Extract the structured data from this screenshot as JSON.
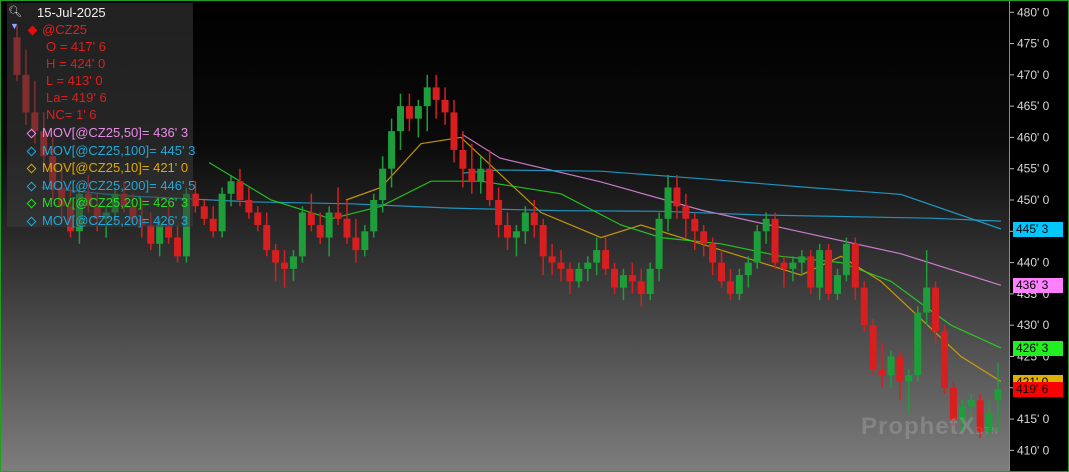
{
  "legend": {
    "date": "15-Jul-2025",
    "symbol": "@CZ25",
    "ohlc": [
      "O = 417' 6",
      "H = 424' 0",
      "L = 413' 0",
      "La= 419' 6",
      "NC= 1' 6"
    ],
    "indicators": [
      {
        "label": "MOV[@CZ25,50]= 436' 3",
        "color": "#e88ae8"
      },
      {
        "label": "MOV[@CZ25,100]= 445' 3",
        "color": "#1fa8d8"
      },
      {
        "label": "MOV[@CZ25,10]= 421' 0",
        "color": "#e0a800"
      },
      {
        "label": "MOV[@CZ25,200]= 446' 5",
        "color": "#1fa8d8"
      },
      {
        "label": "MOV[@CZ25,20]= 426' 3",
        "color": "#22dd22"
      },
      {
        "label": "MOV[@CZ25,20]= 426' 3",
        "color": "#1fa8d8"
      }
    ]
  },
  "watermark": {
    "brand": "ProphetX",
    "suffix": "DTN"
  },
  "price_tags": [
    {
      "label": "445' 3",
      "value": 445.375,
      "bg": "#00c8ff",
      "fg": "#000000"
    },
    {
      "label": "436' 3",
      "value": 436.375,
      "bg": "#ff80ff",
      "fg": "#000000"
    },
    {
      "label": "426' 3",
      "value": 426.375,
      "bg": "#22ee22",
      "fg": "#000000"
    },
    {
      "label": "421' 0",
      "value": 421.0,
      "bg": "#e0b000",
      "fg": "#000000"
    },
    {
      "label": "419' 6",
      "value": 419.75,
      "bg": "#ff0000",
      "fg": "#000000"
    }
  ],
  "colors": {
    "up": "#1e9e3a",
    "down": "#d81e1e"
  },
  "chart_data": {
    "type": "candlestick",
    "ylim": [
      407.5,
      481
    ],
    "yticks": [
      {
        "value": 480,
        "label": "480' 0"
      },
      {
        "value": 475,
        "label": "475' 0"
      },
      {
        "value": 470,
        "label": "470' 0"
      },
      {
        "value": 465,
        "label": "465' 0"
      },
      {
        "value": 460,
        "label": "460' 0"
      },
      {
        "value": 455,
        "label": "455' 0"
      },
      {
        "value": 450,
        "label": "450' 0"
      },
      {
        "value": 445,
        "label": "445' 0"
      },
      {
        "value": 440,
        "label": "440' 0"
      },
      {
        "value": 435,
        "label": "435' 0"
      },
      {
        "value": 430,
        "label": "430' 0"
      },
      {
        "value": 425,
        "label": "425' 0"
      },
      {
        "value": 420,
        "label": "420' 0"
      },
      {
        "value": 415,
        "label": "415' 0"
      },
      {
        "value": 410,
        "label": "410' 0"
      }
    ],
    "candles": [
      [
        476,
        478,
        469,
        470
      ],
      [
        470,
        474,
        462,
        464
      ],
      [
        464,
        469,
        459,
        461
      ],
      [
        461,
        464,
        455,
        457
      ],
      [
        457,
        460,
        450,
        452
      ],
      [
        452,
        455,
        447,
        449
      ],
      [
        449,
        452,
        444,
        445
      ],
      [
        445,
        452,
        443,
        451
      ],
      [
        451,
        454,
        448,
        449
      ],
      [
        449,
        451,
        445,
        447
      ],
      [
        447,
        449,
        444,
        448
      ],
      [
        448,
        452,
        446,
        451
      ],
      [
        451,
        453,
        448,
        449
      ],
      [
        449,
        451,
        446,
        447
      ],
      [
        447,
        450,
        444,
        446
      ],
      [
        446,
        448,
        442,
        443
      ],
      [
        443,
        447,
        441,
        446
      ],
      [
        446,
        449,
        443,
        444
      ],
      [
        444,
        446,
        440,
        441
      ],
      [
        441,
        452,
        440,
        451
      ],
      [
        451,
        453,
        448,
        449
      ],
      [
        449,
        450,
        446,
        447
      ],
      [
        447,
        449,
        444,
        445
      ],
      [
        445,
        452,
        444,
        451
      ],
      [
        451,
        454,
        449,
        453
      ],
      [
        453,
        455,
        449,
        450
      ],
      [
        450,
        452,
        447,
        448
      ],
      [
        448,
        449,
        445,
        446
      ],
      [
        446,
        448,
        441,
        442
      ],
      [
        442,
        443,
        437,
        440
      ],
      [
        440,
        442,
        436,
        439
      ],
      [
        439,
        442,
        437,
        441
      ],
      [
        441,
        449,
        440,
        448
      ],
      [
        448,
        451,
        445,
        446
      ],
      [
        446,
        448,
        443,
        444
      ],
      [
        444,
        449,
        441,
        448
      ],
      [
        448,
        452,
        446,
        447
      ],
      [
        447,
        450,
        443,
        444
      ],
      [
        444,
        447,
        440,
        442
      ],
      [
        442,
        446,
        441,
        445
      ],
      [
        445,
        451,
        444,
        450
      ],
      [
        450,
        457,
        448,
        455
      ],
      [
        455,
        463,
        452,
        461
      ],
      [
        461,
        467,
        458,
        465
      ],
      [
        465,
        467,
        461,
        463
      ],
      [
        463,
        466,
        460,
        465
      ],
      [
        465,
        470,
        461,
        468
      ],
      [
        468,
        470,
        463,
        466
      ],
      [
        466,
        468,
        462,
        464
      ],
      [
        464,
        466,
        456,
        458
      ],
      [
        458,
        461,
        452,
        455
      ],
      [
        455,
        459,
        451,
        453
      ],
      [
        453,
        457,
        451,
        455
      ],
      [
        455,
        458,
        449,
        450
      ],
      [
        450,
        452,
        444,
        446
      ],
      [
        446,
        448,
        442,
        444
      ],
      [
        444,
        446,
        441,
        445
      ],
      [
        445,
        449,
        443,
        448
      ],
      [
        448,
        450,
        444,
        446
      ],
      [
        446,
        447,
        438,
        441
      ],
      [
        441,
        443,
        438,
        440
      ],
      [
        440,
        442,
        437,
        439
      ],
      [
        439,
        440,
        435,
        437
      ],
      [
        437,
        440,
        436,
        439
      ],
      [
        439,
        441,
        437,
        440
      ],
      [
        440,
        444,
        438,
        442
      ],
      [
        442,
        444,
        438,
        439
      ],
      [
        439,
        440,
        435,
        436
      ],
      [
        436,
        439,
        434,
        438
      ],
      [
        438,
        440,
        435,
        437
      ],
      [
        437,
        439,
        433,
        435
      ],
      [
        435,
        440,
        434,
        439
      ],
      [
        439,
        448,
        437,
        447
      ],
      [
        447,
        454,
        445,
        452
      ],
      [
        452,
        454,
        447,
        449
      ],
      [
        449,
        451,
        444,
        447
      ],
      [
        447,
        448,
        442,
        445
      ],
      [
        445,
        446,
        441,
        443
      ],
      [
        443,
        444,
        438,
        440
      ],
      [
        440,
        442,
        436,
        437
      ],
      [
        437,
        439,
        434,
        435
      ],
      [
        435,
        439,
        434,
        438
      ],
      [
        438,
        441,
        436,
        440
      ],
      [
        440,
        446,
        439,
        445
      ],
      [
        445,
        448,
        443,
        447
      ],
      [
        447,
        448,
        439,
        440
      ],
      [
        440,
        441,
        436,
        439
      ],
      [
        439,
        441,
        437,
        440
      ],
      [
        440,
        442,
        438,
        441
      ],
      [
        441,
        442,
        435,
        436
      ],
      [
        436,
        443,
        434,
        442
      ],
      [
        442,
        443,
        434,
        435
      ],
      [
        435,
        439,
        434,
        438
      ],
      [
        438,
        444,
        437,
        443
      ],
      [
        443,
        444,
        434,
        436
      ],
      [
        436,
        437,
        429,
        430
      ],
      [
        430,
        431,
        422,
        423
      ],
      [
        423,
        427,
        420,
        422
      ],
      [
        422,
        426,
        420,
        425
      ],
      [
        425,
        426,
        418,
        421
      ],
      [
        421,
        423,
        416,
        422
      ],
      [
        422,
        433,
        421,
        432
      ],
      [
        432,
        442,
        430,
        436
      ],
      [
        436,
        437,
        427,
        429
      ],
      [
        429,
        430,
        419,
        420
      ],
      [
        420,
        421,
        414,
        415
      ],
      [
        415,
        418,
        413,
        417
      ],
      [
        417,
        419,
        414,
        418
      ],
      [
        418,
        419,
        412,
        413
      ],
      [
        413,
        418,
        412,
        416
      ],
      [
        418,
        424,
        413,
        419.75
      ]
    ],
    "series": [
      {
        "name": "MOV[@CZ25,50]",
        "color": "#e88ae8",
        "values": [
          [
            461,
            460.5
          ],
          [
            499,
            456.7
          ],
          [
            600,
            452.9
          ],
          [
            700,
            448.4
          ],
          [
            800,
            444.9
          ],
          [
            900,
            441.4
          ],
          [
            1000,
            436.375
          ]
        ]
      },
      {
        "name": "MOV[@CZ25,100]",
        "color": "#1fa8d8",
        "values": [
          [
            461,
            454.3
          ],
          [
            499,
            454.8
          ],
          [
            600,
            454.6
          ],
          [
            700,
            453.4
          ],
          [
            800,
            452.1
          ],
          [
            900,
            450.9
          ],
          [
            1000,
            445.375
          ]
        ]
      },
      {
        "name": "MOV[@CZ25,10]",
        "color": "#e0a800",
        "values": [
          [
            345,
            450
          ],
          [
            380,
            452
          ],
          [
            420,
            459
          ],
          [
            460,
            460
          ],
          [
            540,
            448
          ],
          [
            600,
            444
          ],
          [
            640,
            446
          ],
          [
            700,
            443
          ],
          [
            760,
            440
          ],
          [
            800,
            438
          ],
          [
            840,
            441
          ],
          [
            880,
            437
          ],
          [
            920,
            431
          ],
          [
            960,
            425
          ],
          [
            1000,
            421
          ]
        ]
      },
      {
        "name": "MOV[@CZ25,200]",
        "color": "#1fa8d8",
        "values": [
          [
            40,
            452
          ],
          [
            120,
            450.7
          ],
          [
            250,
            449.7
          ],
          [
            350,
            449.4
          ],
          [
            450,
            448.7
          ],
          [
            560,
            448.3
          ],
          [
            660,
            448.2
          ],
          [
            760,
            447.6
          ],
          [
            860,
            447.3
          ],
          [
            930,
            447.1
          ],
          [
            1000,
            446.625
          ]
        ]
      },
      {
        "name": "MOV[@CZ25,20]",
        "color": "#22dd22",
        "values": [
          [
            208,
            456
          ],
          [
            270,
            450
          ],
          [
            330,
            447
          ],
          [
            380,
            449
          ],
          [
            430,
            453
          ],
          [
            480,
            453
          ],
          [
            560,
            451
          ],
          [
            620,
            446
          ],
          [
            660,
            444
          ],
          [
            720,
            443
          ],
          [
            780,
            441
          ],
          [
            840,
            440
          ],
          [
            890,
            437
          ],
          [
            950,
            430
          ],
          [
            1000,
            426.375
          ]
        ]
      }
    ]
  }
}
